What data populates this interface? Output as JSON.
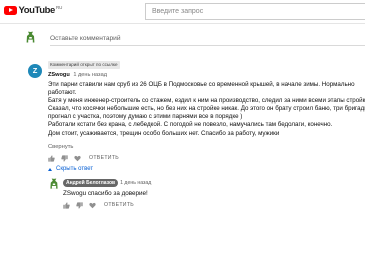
{
  "header": {
    "logo_text": "YouTube",
    "logo_region": "RU",
    "search_placeholder": "Введите запрос"
  },
  "add_comment": {
    "placeholder": "Оставьте комментарий",
    "avatar_icon": "mascot-avatar-icon"
  },
  "comment": {
    "pinned_label": "Комментарий открыт по ссылке",
    "avatar_letter": "Z",
    "author": "ZSwogu",
    "time": "1 день назад",
    "lines": [
      "Эти парни ставили нам сруб из 26 ОЦБ в Подмосковье со временной крышей, в начале зимы. Нормально",
      "работают.",
      "Батя у меня инженер-строитель со стажем, ездил к ним на производство, следил за ними всеми этапы стройки.",
      "Сказал, что косячки небольшие есть, но без них на стройке никак. До этого он брату строил баню, три бригады",
      "прогнал с участка, поэтому думаю с этими парнями все в порядке )",
      "Работали кстати без крана, с лебедкой. С погодой не повезло, намучались там бедолаги, конечно.",
      "Дом стоит, усаживается, трещин особо больших нет. Спасибо за работу, мужики"
    ],
    "collapse_label": "Свернуть",
    "reply_label": "ОТВЕТИТЬ"
  },
  "replies_toggle": {
    "label": "Скрыть ответ",
    "color": "#065fd4"
  },
  "reply": {
    "author": "Андрей Белоглазов",
    "time": "1 день назад",
    "text": "ZSwogu спасибо за доверие!",
    "reply_label": "ОТВЕТИТЬ"
  },
  "colors": {
    "brand_red": "#ff0000",
    "avatar_blue": "#1e88b8",
    "link_blue": "#065fd4",
    "mascot_green": "#4a8a32"
  }
}
